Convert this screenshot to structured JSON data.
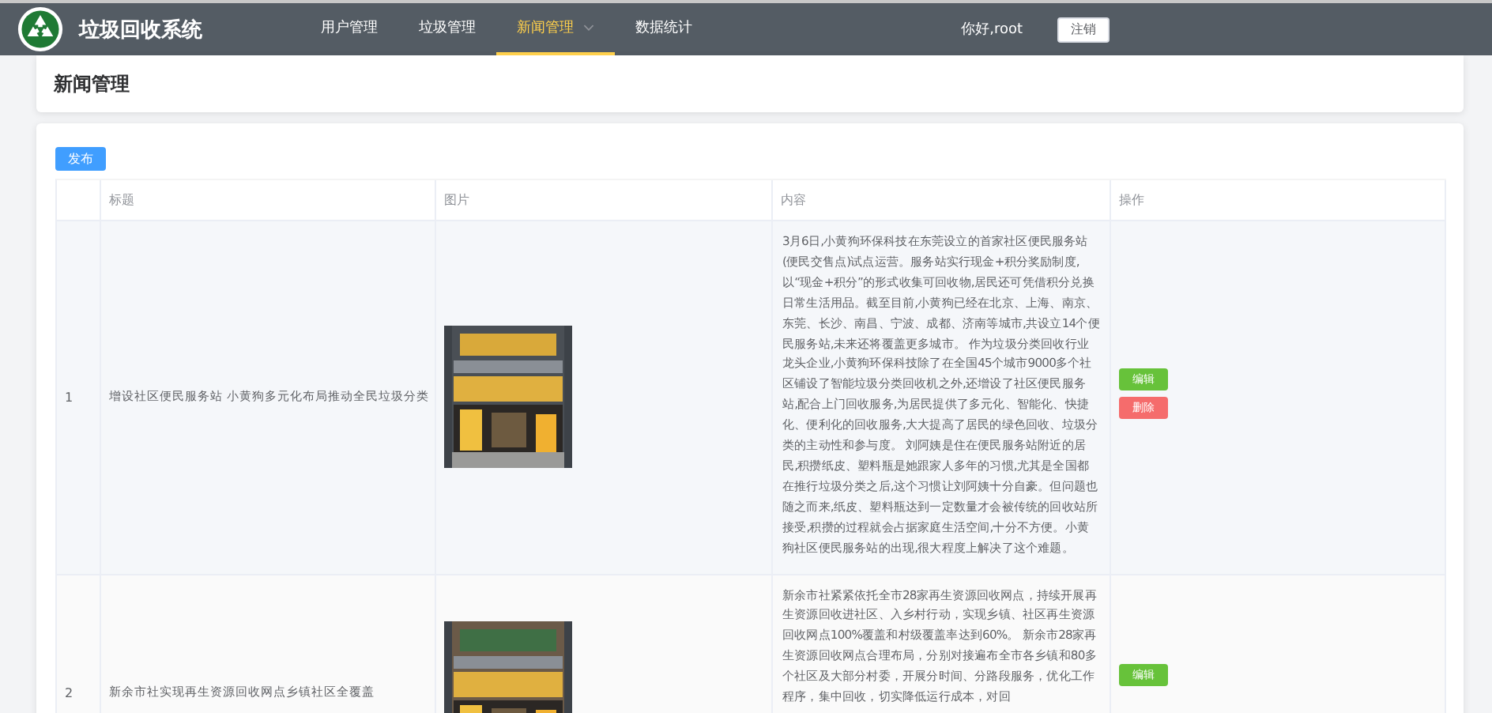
{
  "app": {
    "title": "垃圾回收系统"
  },
  "nav": [
    {
      "label": "用户管理",
      "selected": false,
      "has_menu": false
    },
    {
      "label": "垃圾管理",
      "selected": false,
      "has_menu": false
    },
    {
      "label": "新闻管理",
      "selected": true,
      "has_menu": true
    },
    {
      "label": "数据统计",
      "selected": false,
      "has_menu": false
    }
  ],
  "user": {
    "greeting": "你好,root",
    "logout": "注销"
  },
  "page_title": "新闻管理",
  "publish_button": "发布",
  "table": {
    "columns": [
      "",
      "标题",
      "图片",
      "内容",
      "操作"
    ],
    "rows": [
      {
        "index": "1",
        "title": "增设社区便民服务站 小黄狗多元化布局推动全民垃圾分类",
        "image": {
          "kind": "picture"
        },
        "content": "3月6日,小黄狗环保科技在东莞设立的首家社区便民服务站(便民交售点)试点运营。服务站实行现金+积分奖励制度,以“现金+积分”的形式收集可回收物,居民还可凭借积分兑换日常生活用品。截至目前,小黄狗已经在北京、上海、南京、东莞、长沙、南昌、宁波、成都、济南等城市,共设立14个便民服务站,未来还将覆盖更多城市。 作为垃圾分类回收行业龙头企业,小黄狗环保科技除了在全国45个城市9000多个社区铺设了智能垃圾分类回收机之外,还增设了社区便民服务站,配合上门回收服务,为居民提供了多元化、智能化、快捷化、便利化的回收服务,大大提高了居民的绿色回收、垃圾分类的主动性和参与度。 刘阿姨是住在便民服务站附近的居民,积攒纸皮、塑料瓶是她跟家人多年的习惯,尤其是全国都在推行垃圾分类之后,这个习惯让刘阿姨十分自豪。但问题也随之而来,纸皮、塑料瓶达到一定数量才会被传统的回收站所接受,积攒的过程就会占据家庭生活空间,十分不方便。小黄狗社区便民服务站的出现,很大程度上解决了这个难题。",
        "actions": [
          "编辑",
          "删除"
        ]
      },
      {
        "index": "2",
        "title": "新余市社实现再生资源回收网点乡镇社区全覆盖",
        "image": {
          "kind": "picture"
        },
        "content": "新余市社紧紧依托全市28家再生资源回收网点，持续开展再生资源回收进社区、入乡村行动，实现乡镇、社区再生资源回收网点100%覆盖和村级覆盖率达到60%。 新余市28家再生资源回收网点合理布局，分别对接遍布全市各乡镇和80多个社区及大部分村委，开展分时间、分路段服务，优化工作程序，集中回收，切实降低运行成本，对回",
        "actions": [
          "编辑"
        ]
      }
    ]
  }
}
